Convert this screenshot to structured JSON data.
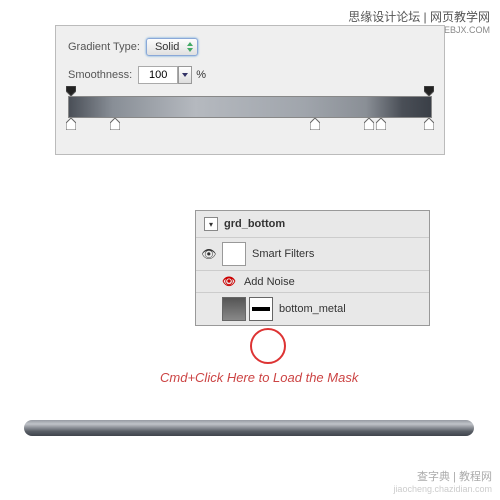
{
  "header": {
    "top_text": "思缘设计论坛 | 网页教学网",
    "top_sub": "WWW.WEBJX.COM"
  },
  "gradient_editor": {
    "type_label": "Gradient Type:",
    "type_value": "Solid",
    "smoothness_label": "Smoothness:",
    "smoothness_value": "100",
    "percent": "%"
  },
  "layers": {
    "group_name": "grd_bottom",
    "smart_filters": "Smart Filters",
    "add_noise": "Add Noise",
    "bottom_metal": "bottom_metal"
  },
  "annotation": "Cmd+Click Here to Load the Mask",
  "footer": {
    "text": "查字典 | 教程网",
    "sub": "jiaocheng.chazidian.com"
  }
}
